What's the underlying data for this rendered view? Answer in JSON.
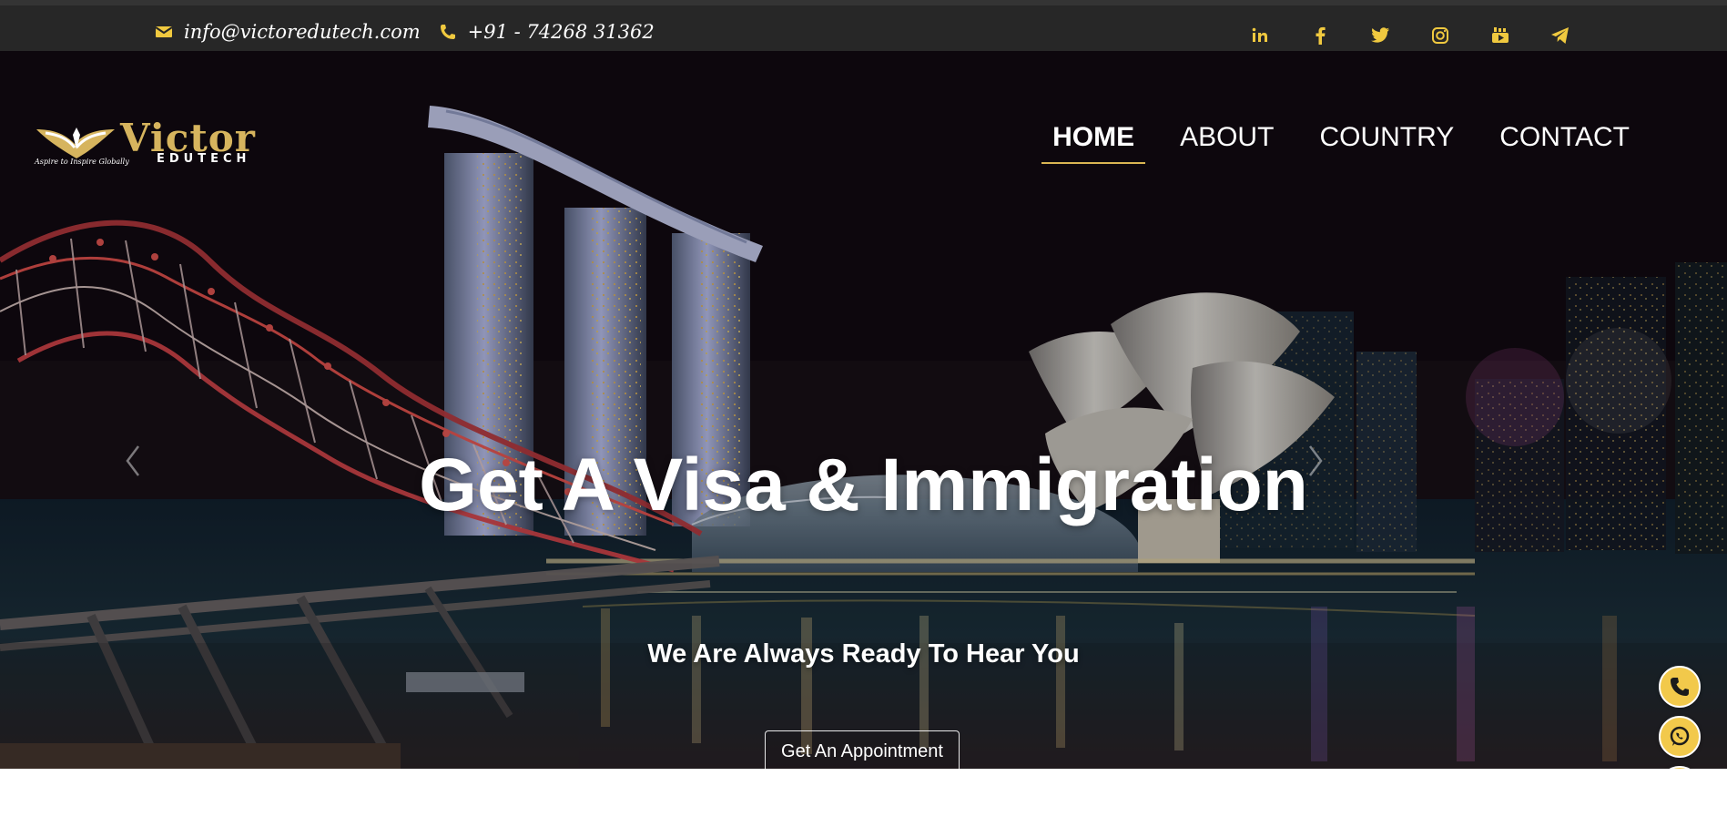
{
  "topbar": {
    "email": "info@victoredutech.com",
    "phone": "+91 - 74268 31362",
    "social_icons": [
      "linkedin-icon",
      "facebook-icon",
      "twitter-icon",
      "instagram-icon",
      "youtube-icon",
      "telegram-icon"
    ]
  },
  "brand": {
    "name": "Victor",
    "subname": "EDUTECH",
    "tagline": "Aspire to Inspire Globally"
  },
  "nav": {
    "items": [
      {
        "label": "HOME",
        "active": true
      },
      {
        "label": "ABOUT",
        "active": false
      },
      {
        "label": "COUNTRY",
        "active": false
      },
      {
        "label": "CONTACT",
        "active": false
      }
    ]
  },
  "hero": {
    "title": "Get A Visa & Immigration",
    "subtitle": "We Are Always Ready To Hear You",
    "cta_label": "Get An Appointment",
    "slides": [
      {
        "active": true
      },
      {
        "active": false
      },
      {
        "active": false
      }
    ]
  },
  "floating_actions": {
    "email_symbol": "@",
    "icons": [
      "phone-icon",
      "whatsapp-icon",
      "email-icon"
    ]
  },
  "colors": {
    "accent": "#f0c93f",
    "topbar": "#272727",
    "nav_active_underline": "#d9b553",
    "floating_button": "#f2c94b"
  }
}
